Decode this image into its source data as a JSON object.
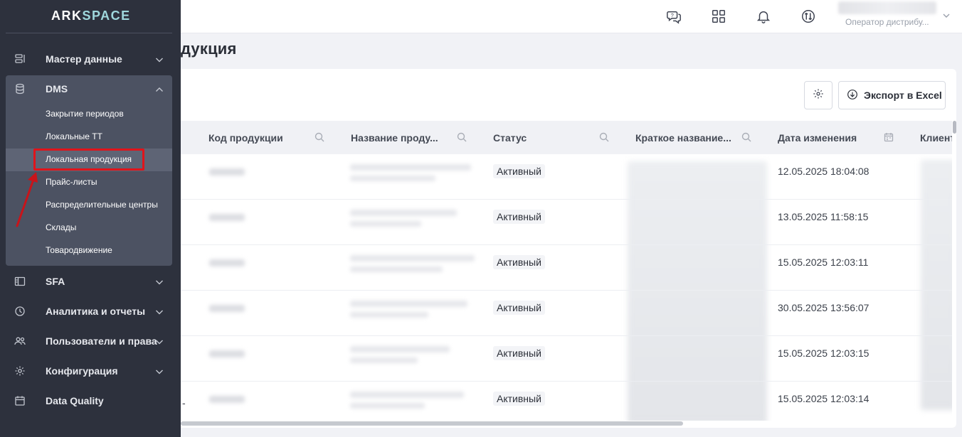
{
  "app": {
    "logo_main": "ARK",
    "logo_accent": "SPACE"
  },
  "topbar": {
    "icons": [
      "help-chat-icon",
      "apps-grid-icon",
      "bell-icon",
      "exchange-icon"
    ],
    "user_role": "Оператор дистрибу..."
  },
  "sidebar": {
    "items": [
      {
        "label": "Мастер данные",
        "icon": "master-data-icon",
        "expanded": false
      },
      {
        "label": "DMS",
        "icon": "database-icon",
        "expanded": true
      },
      {
        "label": "SFA",
        "icon": "sfa-icon",
        "expanded": false
      },
      {
        "label": "Аналитика и отчеты",
        "icon": "analytics-icon",
        "expanded": false
      },
      {
        "label": "Пользователи и права",
        "icon": "users-icon",
        "expanded": false
      },
      {
        "label": "Конфигурация",
        "icon": "gear-icon",
        "expanded": false
      },
      {
        "label": "Data Quality",
        "icon": "calendar-icon",
        "expanded": false
      }
    ],
    "dms_sub": [
      {
        "label": "Закрытие периодов"
      },
      {
        "label": "Локальные ТТ"
      },
      {
        "label": "Локальная продукция",
        "active": true
      },
      {
        "label": "Прайс-листы"
      },
      {
        "label": "Распределительные центры"
      },
      {
        "label": "Склады"
      },
      {
        "label": "Товародвижение"
      }
    ]
  },
  "page": {
    "title": "дукция"
  },
  "toolbar": {
    "export_label": "Экспорт в Excel"
  },
  "table": {
    "columns": [
      {
        "label": "Код продукции"
      },
      {
        "label": "Название проду..."
      },
      {
        "label": "Статус"
      },
      {
        "label": "Краткое название..."
      },
      {
        "label": "Дата изменения"
      },
      {
        "label": "Клиент"
      }
    ],
    "rows": [
      {
        "status": "Активный",
        "date": "12.05.2025 18:04:08"
      },
      {
        "status": "Активный",
        "date": "13.05.2025 11:58:15"
      },
      {
        "status": "Активный",
        "date": "15.05.2025 12:03:11"
      },
      {
        "status": "Активный",
        "date": "30.05.2025 13:56:07"
      },
      {
        "status": "Активный",
        "date": "15.05.2025 12:03:15"
      },
      {
        "status": "Активный",
        "date": "15.05.2025 12:03:14",
        "leading": "-"
      }
    ]
  },
  "colors": {
    "sidebar_bg": "#2d313d",
    "highlight": "#e0141b",
    "accent": "#9fd8dd"
  }
}
